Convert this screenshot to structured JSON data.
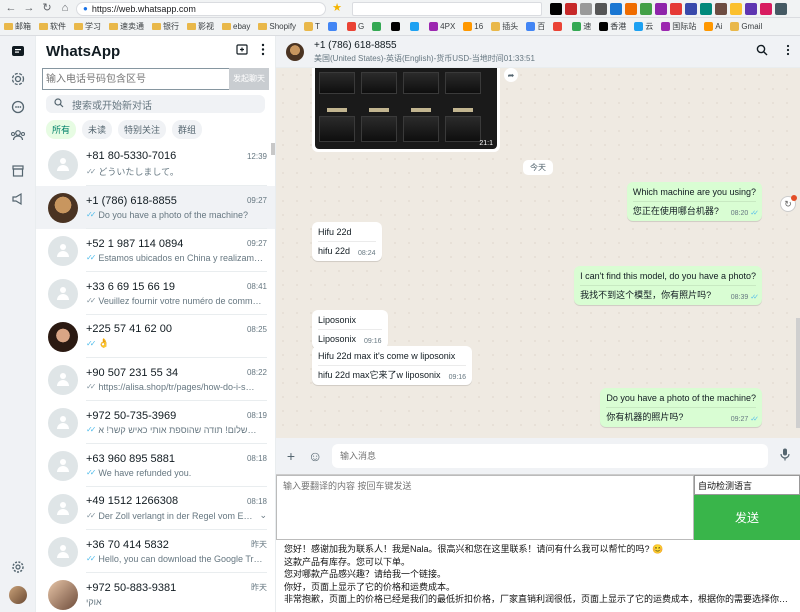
{
  "browser": {
    "url": "https://web.whatsapp.com",
    "bookmarks": [
      "邮箱",
      "软件",
      "学习",
      "速卖通",
      "银行",
      "影视",
      "ebay",
      "Shopify",
      "T",
      "",
      "G",
      "",
      "",
      "",
      "4PX",
      "16",
      "插头",
      "百",
      "",
      "速",
      "香港",
      "云",
      "国际站",
      "Ai",
      "Gmail"
    ]
  },
  "sidebar": {
    "title": "WhatsApp",
    "phone_placeholder": "输入电话号码包含区号",
    "start_chat_label": "发起聊天",
    "search_placeholder": "搜索或开始新对话",
    "filters": [
      "所有",
      "未读",
      "特别关注",
      "群组"
    ],
    "chats": [
      {
        "name": "+81 80-5330-7016",
        "time": "12:39",
        "preview": "どういたしまして。",
        "ticks": "grey",
        "avatar": "default"
      },
      {
        "name": "+1 (786) 618-8855",
        "time": "09:27",
        "preview": "Do you have a photo of the machine?",
        "ticks": "blue",
        "avatar": "photo1",
        "selected": true
      },
      {
        "name": "+52 1 987 114 0894",
        "time": "09:27",
        "preview": "Estamos ubicados en China y realizamo…",
        "ticks": "blue",
        "avatar": "default"
      },
      {
        "name": "+33 6 69 15 66 19",
        "time": "08:41",
        "preview": "Veuillez fournir votre numéro de comm…",
        "ticks": "grey",
        "avatar": "default"
      },
      {
        "name": "+225 57 41 62 00",
        "time": "08:25",
        "preview": "👌",
        "ticks": "blue",
        "avatar": "photo2"
      },
      {
        "name": "+90 507 231 55 34",
        "time": "08:22",
        "preview": "https://alisa.shop/tr/pages/how-do-i-s…",
        "ticks": "grey",
        "avatar": "default"
      },
      {
        "name": "+972 50-735-3969",
        "time": "08:19",
        "preview": "שלום! תודה שהוספת אותי כאיש קשר! א…",
        "ticks": "blue",
        "avatar": "default"
      },
      {
        "name": "+63 960 895 5881",
        "time": "08:18",
        "preview": "We have refunded you.",
        "ticks": "blue",
        "avatar": "default"
      },
      {
        "name": "+49 1512 1266308",
        "time": "08:18",
        "preview": "Der Zoll verlangt in der Regel vom E…",
        "ticks": "grey",
        "avatar": "default"
      },
      {
        "name": "+36 70 414 5832",
        "time": "昨天",
        "preview": "Hello, you can download the Google Tr…",
        "ticks": "blue",
        "avatar": "default"
      },
      {
        "name": "+972 50-883-9381",
        "time": "昨天",
        "preview": "אוקי",
        "ticks": "",
        "avatar": "photo3"
      }
    ]
  },
  "conversation": {
    "name": "+1 (786) 618-8855",
    "subtitle": "美国(United States)-英语(English)-货币USD-当地时间01:33:51",
    "image_time": "21:1",
    "date_label": "今天",
    "messages": [
      {
        "dir": "out",
        "text": "Which machine are you using?",
        "translation": "您正在使用哪台机器?",
        "time": "08:20"
      },
      {
        "dir": "in",
        "text": "Hifu 22d",
        "translation": "hifu 22d",
        "time": "08:24"
      },
      {
        "dir": "out",
        "text": "I can't find this model, do you have a photo?",
        "translation": "我找不到这个模型，你有照片吗?",
        "time": "08:39"
      },
      {
        "dir": "in",
        "text": "Liposonix",
        "translation": "Liposonix",
        "time": "09:16"
      },
      {
        "dir": "in",
        "text": "Hifu 22d max it's come w liposonix",
        "translation": "hifu 22d max它来了w liposonix",
        "time": "09:16"
      },
      {
        "dir": "out",
        "text": "Do you have a photo of the machine?",
        "translation": "你有机器的照片吗?",
        "time": "09:27"
      }
    ],
    "compose_placeholder": "输入消息",
    "translate_placeholder": "输入要翻译的内容 按回车键发送",
    "lang_label": "自动检测语言",
    "send_label": "发送",
    "quick_replies": [
      "您好！感谢加我为联系人！我是Nala。很高兴和您在这里联系！请问有什么我可以帮忙的吗? 😊",
      "这款产品有库存。您可以下单。",
      "您对哪款产品感兴趣？请给我一个链接。",
      "你好，页面上显示了它的价格和运费成本。",
      "非常抱歉，页面上的价格已经是我们的最低折扣价格，厂家直销利润很低，页面上显示了它的运费成本，根据你的需要选择你…"
    ]
  },
  "colors": {
    "accent": "#008069",
    "out_bubble": "#d9fdd3",
    "send": "#39b54a",
    "blue_tick": "#53bdeb"
  }
}
